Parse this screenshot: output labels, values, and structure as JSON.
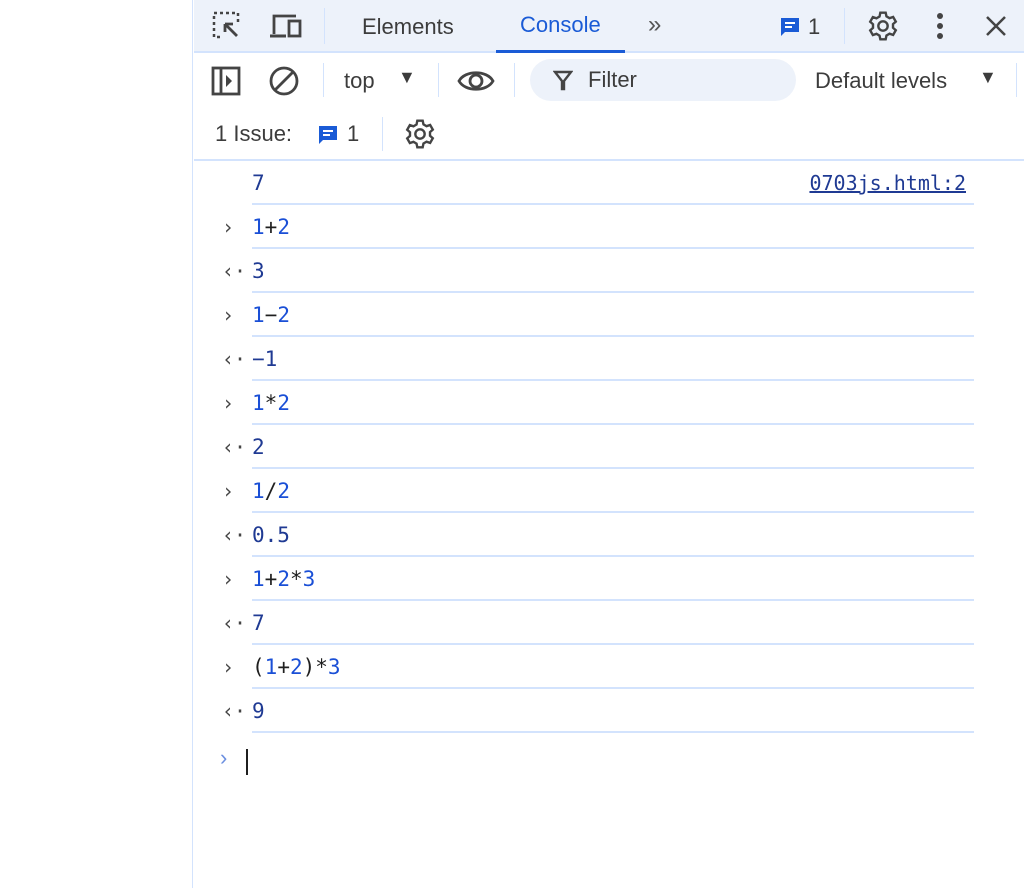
{
  "tabs": {
    "elements": "Elements",
    "console": "Console",
    "issues_count": "1"
  },
  "toolbar": {
    "context": "top",
    "filter_placeholder": "Filter",
    "levels": "Default levels"
  },
  "issues": {
    "label": "1 Issue:",
    "count": "1"
  },
  "colors": {
    "accent": "#1a5bd6",
    "number": "#1a4fd6",
    "result": "#1f3a93",
    "border": "#d3e3fd"
  },
  "console": {
    "log": {
      "text": "7",
      "source": "0703js.html:2"
    },
    "entries": [
      {
        "kind": "input",
        "tokens": [
          [
            "1",
            "num"
          ],
          [
            "+",
            "op"
          ],
          [
            "2",
            "num"
          ]
        ]
      },
      {
        "kind": "result",
        "text": "3"
      },
      {
        "kind": "input",
        "tokens": [
          [
            "1",
            "num"
          ],
          [
            "−",
            "op"
          ],
          [
            "2",
            "num"
          ]
        ]
      },
      {
        "kind": "result",
        "text": "−1"
      },
      {
        "kind": "input",
        "tokens": [
          [
            "1",
            "num"
          ],
          [
            "*",
            "op"
          ],
          [
            "2",
            "num"
          ]
        ]
      },
      {
        "kind": "result",
        "text": "2"
      },
      {
        "kind": "input",
        "tokens": [
          [
            "1",
            "num"
          ],
          [
            "/",
            "op"
          ],
          [
            "2",
            "num"
          ]
        ]
      },
      {
        "kind": "result",
        "text": "0.5"
      },
      {
        "kind": "input",
        "tokens": [
          [
            "1",
            "num"
          ],
          [
            "+",
            "op"
          ],
          [
            "2",
            "num"
          ],
          [
            "*",
            "op"
          ],
          [
            "3",
            "num"
          ]
        ]
      },
      {
        "kind": "result",
        "text": "7"
      },
      {
        "kind": "input",
        "tokens": [
          [
            "(",
            "op"
          ],
          [
            "1",
            "num"
          ],
          [
            "+",
            "op"
          ],
          [
            "2",
            "num"
          ],
          [
            ")*",
            "op"
          ],
          [
            "3",
            "num"
          ]
        ]
      },
      {
        "kind": "result",
        "text": "9"
      }
    ]
  }
}
